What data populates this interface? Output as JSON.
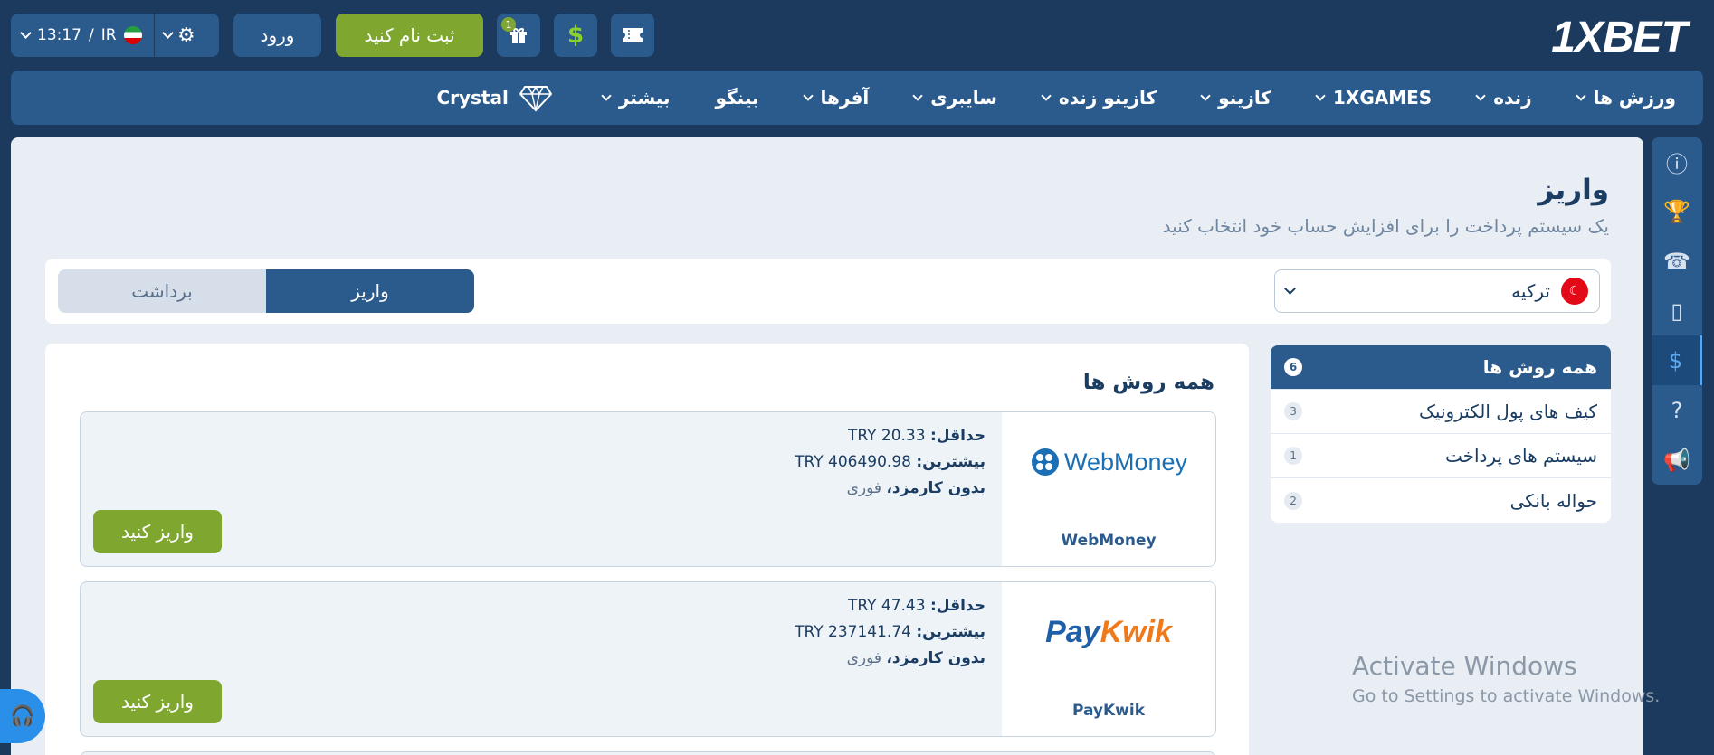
{
  "header": {
    "logo": "1XBET",
    "time": "13:17",
    "separator": "/",
    "region": "IR",
    "login_label": "ورود",
    "register_label": "ثبت نام کنید",
    "gift_badge": "1",
    "dollar_icon": "$",
    "gear_icon": "⚙"
  },
  "nav": {
    "items": [
      {
        "label": "ورزش ها"
      },
      {
        "label": "زنده"
      },
      {
        "label": "1XGAMES"
      },
      {
        "label": "کازینو"
      },
      {
        "label": "کازینو زنده"
      },
      {
        "label": "سایبری"
      },
      {
        "label": "آفرها"
      },
      {
        "label": "بینگو"
      },
      {
        "label": "بیشتر"
      },
      {
        "label": "Crystal"
      }
    ]
  },
  "page": {
    "title": "واریز",
    "subtitle": "یک سیستم پرداخت را برای افزایش حساب خود انتخاب کنید",
    "country": "ترکیه",
    "tab_deposit": "واریز",
    "tab_withdraw": "برداشت",
    "methods_title": "همه روش ها"
  },
  "categories": [
    {
      "label": "همه روش ها",
      "count": "6"
    },
    {
      "label": "کیف های پول الکترونیک",
      "count": "3"
    },
    {
      "label": "سیستم های پرداخت",
      "count": "1"
    },
    {
      "label": "حواله بانکی",
      "count": "2"
    }
  ],
  "methods": [
    {
      "name": "WebMoney",
      "min_label": "حداقل:",
      "min": "TRY 20.33",
      "max_label": "بیشترین:",
      "max": "TRY 406490.98",
      "fee": "بدون کارمزد،",
      "speed": "فوری",
      "button": "واریز کنید"
    },
    {
      "name": "PayKwik",
      "min_label": "حداقل:",
      "min": "TRY 47.43",
      "max_label": "بیشترین:",
      "max": "TRY 237141.74",
      "fee": "بدون کارمزد،",
      "speed": "فوری",
      "button": "واریز کنید"
    }
  ],
  "watermark": {
    "line1": "Activate Windows",
    "line2": "Go to Settings to activate Windows."
  },
  "colors": {
    "brand_blue": "#2b5a8c",
    "bg_dark": "#1c3a5d",
    "accent_green": "#7fa730"
  }
}
